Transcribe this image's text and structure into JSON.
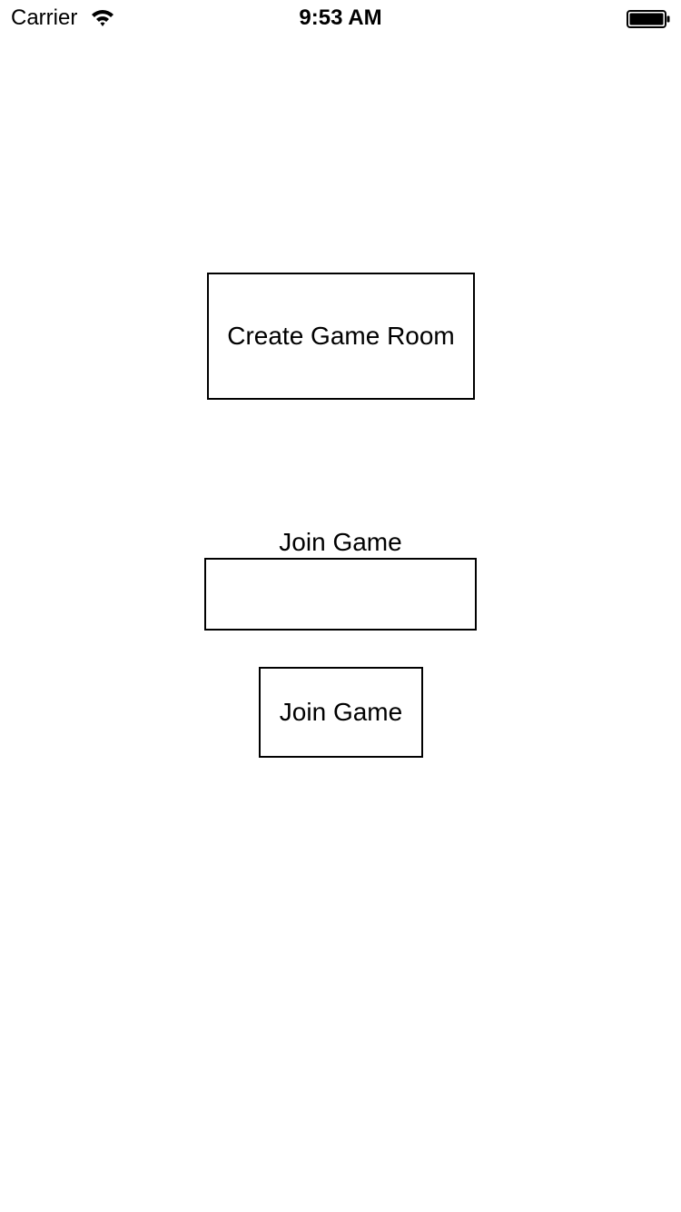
{
  "status_bar": {
    "carrier": "Carrier",
    "time": "9:53 AM",
    "wifi_icon": "wifi-icon",
    "battery_icon": "battery-icon"
  },
  "main": {
    "create_room_label": "Create Game Room",
    "join_section_label": "Join Game",
    "join_code_value": "",
    "join_button_label": "Join Game"
  }
}
